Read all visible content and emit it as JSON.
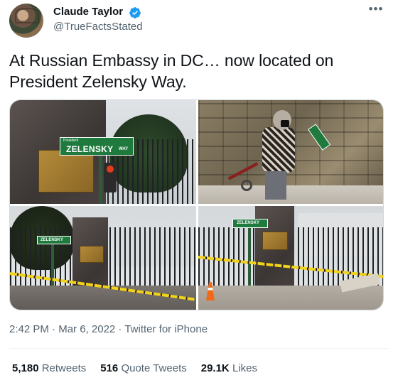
{
  "author": {
    "display_name": "Claude Taylor",
    "handle": "@TrueFactsStated",
    "verified_color": "#1d9bf0"
  },
  "tweet": {
    "text": "At Russian Embassy in DC… now located on President Zelensky Way."
  },
  "media": {
    "sign_label": "ZELENSKY",
    "sign_way": "WAY",
    "sign_president": "President"
  },
  "meta": {
    "time": "2:42 PM",
    "sep1": " · ",
    "date": "Mar 6, 2022",
    "sep2": " · ",
    "source": "Twitter for iPhone"
  },
  "stats": {
    "retweets_count": "5,180",
    "retweets_label": "Retweets",
    "quotes_count": "516",
    "quotes_label": "Quote Tweets",
    "likes_count": "29.1K",
    "likes_label": "Likes"
  },
  "icons": {
    "more": "more-icon",
    "verified": "verified-badge-icon"
  },
  "colors": {
    "text_primary": "#0f1419",
    "text_secondary": "#536471",
    "divider": "#eff3f4"
  }
}
